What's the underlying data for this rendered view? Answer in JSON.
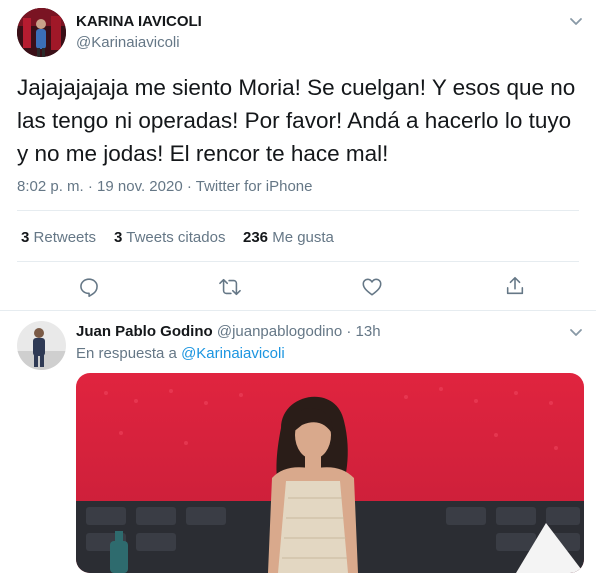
{
  "main_tweet": {
    "author_name": "KARINA IAVICOLI",
    "handle": "@Karinaiavicoli",
    "text_lines": [
      "Jajajajajaja me siento Moria! Se cuelgan! Y esos que no",
      "las tengo ni operadas! Por favor! Andá a hacerlo lo tuyo",
      "y no me jodas! El rencor te hace mal!"
    ],
    "time": "8:02 p. m.",
    "date": "19 nov. 2020",
    "source": "Twitter for iPhone",
    "separator": "·",
    "stats": {
      "retweets_count": "3",
      "retweets_label": "Retweets",
      "quotes_count": "3",
      "quotes_label": "Tweets citados",
      "likes_count": "236",
      "likes_label": "Me gusta"
    }
  },
  "reply": {
    "author_name": "Juan Pablo Godino",
    "handle": "@juanpablogodino",
    "separator": "·",
    "time": "13h",
    "reply_prefix": "En respuesta a",
    "reply_to": "@Karinaiavicoli"
  },
  "colors": {
    "text": "#14171a",
    "secondary": "#657786",
    "link": "#1b95e0",
    "divider": "#e6ecf0",
    "icon": "#657786",
    "photo_bg": "#d4223f"
  },
  "icons": [
    "chevron-down-icon",
    "reply-icon",
    "retweet-icon",
    "like-icon",
    "share-icon"
  ]
}
